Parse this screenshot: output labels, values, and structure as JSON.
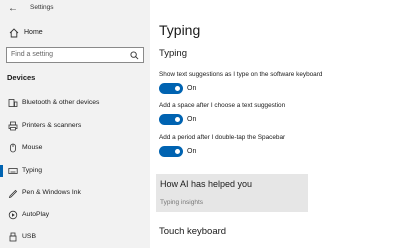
{
  "window": {
    "title": "Settings",
    "back_glyph": "←"
  },
  "sidebar": {
    "home_label": "Home",
    "search_placeholder": "Find a setting",
    "section_header": "Devices",
    "items": [
      {
        "label": "Bluetooth & other devices",
        "icon": "bluetooth-icon"
      },
      {
        "label": "Printers & scanners",
        "icon": "printer-icon"
      },
      {
        "label": "Mouse",
        "icon": "mouse-icon"
      },
      {
        "label": "Typing",
        "icon": "keyboard-icon",
        "active": true
      },
      {
        "label": "Pen & Windows Ink",
        "icon": "pen-icon"
      },
      {
        "label": "AutoPlay",
        "icon": "autoplay-icon"
      },
      {
        "label": "USB",
        "icon": "usb-icon"
      }
    ]
  },
  "main": {
    "page_title": "Typing",
    "section_title": "Typing",
    "settings": [
      {
        "description": "Show text suggestions as I type on the software keyboard",
        "state": "On"
      },
      {
        "description": "Add a space after I choose a text suggestion",
        "state": "On"
      },
      {
        "description": "Add a period after I double-tap the Spacebar",
        "state": "On"
      }
    ],
    "ai_panel": {
      "title": "How AI has helped you",
      "link": "Typing insights"
    },
    "next_section": "Touch keyboard"
  },
  "colors": {
    "accent": "#0063b1",
    "sidebar_bg": "#f2f2f2",
    "panel_bg": "#e6e6e6"
  }
}
